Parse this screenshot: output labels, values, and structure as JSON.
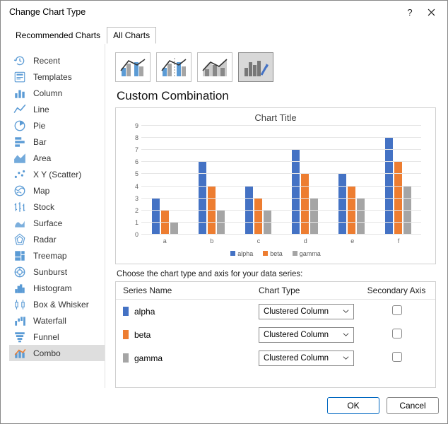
{
  "dialog": {
    "title": "Change Chart Type"
  },
  "tabs": {
    "recommended": "Recommended Charts",
    "all": "All Charts"
  },
  "sidebar": {
    "items": [
      {
        "label": "Recent"
      },
      {
        "label": "Templates"
      },
      {
        "label": "Column"
      },
      {
        "label": "Line"
      },
      {
        "label": "Pie"
      },
      {
        "label": "Bar"
      },
      {
        "label": "Area"
      },
      {
        "label": "X Y (Scatter)"
      },
      {
        "label": "Map"
      },
      {
        "label": "Stock"
      },
      {
        "label": "Surface"
      },
      {
        "label": "Radar"
      },
      {
        "label": "Treemap"
      },
      {
        "label": "Sunburst"
      },
      {
        "label": "Histogram"
      },
      {
        "label": "Box & Whisker"
      },
      {
        "label": "Waterfall"
      },
      {
        "label": "Funnel"
      },
      {
        "label": "Combo"
      }
    ]
  },
  "subtype_title": "Custom Combination",
  "series_instruction": "Choose the chart type and axis for your data series:",
  "series_header": {
    "name": "Series Name",
    "type": "Chart Type",
    "secondary": "Secondary Axis"
  },
  "series": [
    {
      "name": "alpha",
      "chart_type": "Clustered Column",
      "color": "#4472c4"
    },
    {
      "name": "beta",
      "chart_type": "Clustered Column",
      "color": "#ed7d31"
    },
    {
      "name": "gamma",
      "chart_type": "Clustered Column",
      "color": "#a5a5a5"
    }
  ],
  "buttons": {
    "ok": "OK",
    "cancel": "Cancel"
  },
  "chart_data": {
    "type": "bar",
    "title": "Chart Title",
    "categories": [
      "a",
      "b",
      "c",
      "d",
      "e",
      "f"
    ],
    "ylim": [
      0,
      9
    ],
    "yticks": [
      0,
      1,
      2,
      3,
      4,
      5,
      6,
      7,
      8,
      9
    ],
    "series": [
      {
        "name": "alpha",
        "values": [
          3,
          6,
          4,
          7,
          5,
          8
        ]
      },
      {
        "name": "beta",
        "values": [
          2,
          4,
          3,
          5,
          4,
          6
        ]
      },
      {
        "name": "gamma",
        "values": [
          1,
          2,
          2,
          3,
          3,
          4
        ]
      }
    ],
    "legend": [
      "alpha",
      "beta",
      "gamma"
    ]
  }
}
